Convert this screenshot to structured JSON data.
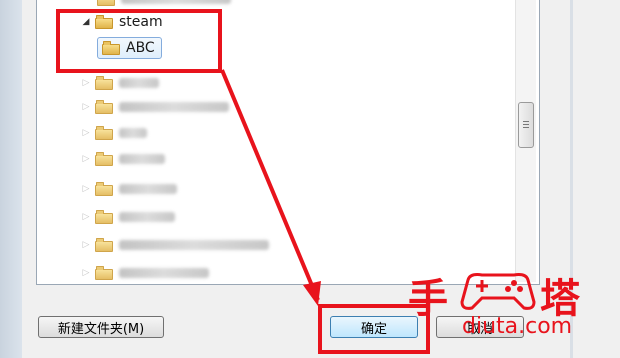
{
  "tree": {
    "expanded_folder": "steam",
    "selected_folder": "ABC",
    "blurred_rows": 9
  },
  "buttons": {
    "new_folder": "新建文件夹(M)",
    "ok": "确定",
    "cancel": "取消"
  },
  "watermark": {
    "logo_text_left": "手",
    "logo_text_right": "塔",
    "url": "diuta.com"
  },
  "colors": {
    "annotation_red": "#e8131c",
    "selection_blue": "#84acdd",
    "folder_yellow": "#e0b44a"
  }
}
